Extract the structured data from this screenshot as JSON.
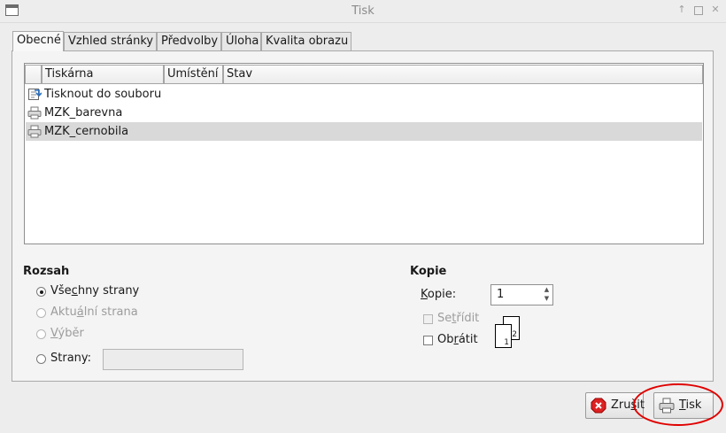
{
  "window": {
    "title": "Tisk",
    "icons": {
      "app": "window-icon",
      "up": "arrow-up-icon",
      "maximize": "maximize-icon",
      "close": "close-icon"
    }
  },
  "tabs": [
    {
      "label": "Obecné",
      "active": true
    },
    {
      "label": "Vzhled stránky",
      "active": false
    },
    {
      "label": "Předvolby",
      "active": false
    },
    {
      "label": "Úloha",
      "active": false
    },
    {
      "label": "Kvalita obrazu",
      "active": false
    }
  ],
  "printer_list": {
    "columns": [
      "Tiskárna",
      "Umístění",
      "Stav"
    ],
    "rows": [
      {
        "name": "Tisknout do souboru",
        "icon": "print-to-file-icon",
        "selected": false
      },
      {
        "name": "MZK_barevna",
        "icon": "printer-icon",
        "selected": false
      },
      {
        "name": "MZK_cernobila",
        "icon": "printer-icon",
        "selected": true
      }
    ]
  },
  "range": {
    "title": "Rozsah",
    "all_pre": "Vše",
    "all_mn": "c",
    "all_post": "hny strany",
    "current_pre": "Aktu",
    "current_mn": "á",
    "current_post": "lní strana",
    "selection_mn": "V",
    "selection_post": "ýběr",
    "pages_label": "Strany:",
    "pages_value": "",
    "selected": "all"
  },
  "copies": {
    "title": "Kopie",
    "label_mn": "K",
    "label_post": "opie:",
    "value": "1",
    "collate_pre": "Se",
    "collate_mn": "t",
    "collate_post": "řídit",
    "collate_checked": false,
    "collate_enabled": false,
    "reverse_pre": "Ob",
    "reverse_mn": "r",
    "reverse_post": "átit",
    "reverse_checked": false,
    "page_numbers": [
      "1",
      "2"
    ]
  },
  "buttons": {
    "cancel_pre": "Zru",
    "cancel_mn": "š",
    "cancel_post": "it",
    "print_mn": "T",
    "print_post": "isk"
  },
  "colors": {
    "highlight": "#e00000",
    "selected_row": "#d9d9d9"
  }
}
